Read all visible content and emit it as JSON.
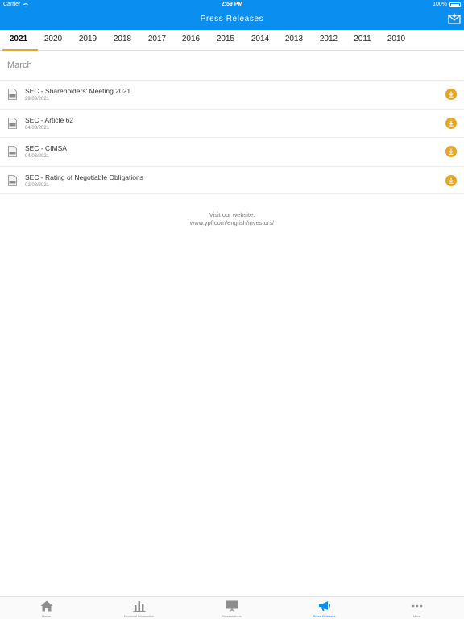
{
  "status": {
    "carrier": "Carrier",
    "time": "2:59 PM",
    "battery": "100%"
  },
  "header": {
    "title": "Press Releases",
    "mail_icon": "mail-icon"
  },
  "years": [
    "2021",
    "2020",
    "2019",
    "2018",
    "2017",
    "2016",
    "2015",
    "2014",
    "2013",
    "2012",
    "2011",
    "2010"
  ],
  "selected_year": "2021",
  "month": "March",
  "releases": [
    {
      "title": "SEC - Shareholders' Meeting 2021",
      "date": "29/03/2021"
    },
    {
      "title": "SEC - Article 62",
      "date": "04/03/2021"
    },
    {
      "title": "SEC - CIMSA",
      "date": "04/03/2021"
    },
    {
      "title": "SEC - Rating of Negotiable Obligations",
      "date": "02/03/2021"
    }
  ],
  "footer": {
    "visit_label": "Visit our website:",
    "url": "www.ypf.com/english/investors/"
  },
  "tabs": [
    {
      "label": "Home",
      "icon": "home-icon"
    },
    {
      "label": "Financial Information",
      "icon": "bar-chart-icon"
    },
    {
      "label": "Presentations",
      "icon": "presentation-icon"
    },
    {
      "label": "Press Releases",
      "icon": "megaphone-icon"
    },
    {
      "label": "More",
      "icon": "more-icon"
    }
  ],
  "active_tab": "Press Releases",
  "colors": {
    "brand_blue": "#0a8ef0",
    "accent_gold": "#e3a626"
  }
}
